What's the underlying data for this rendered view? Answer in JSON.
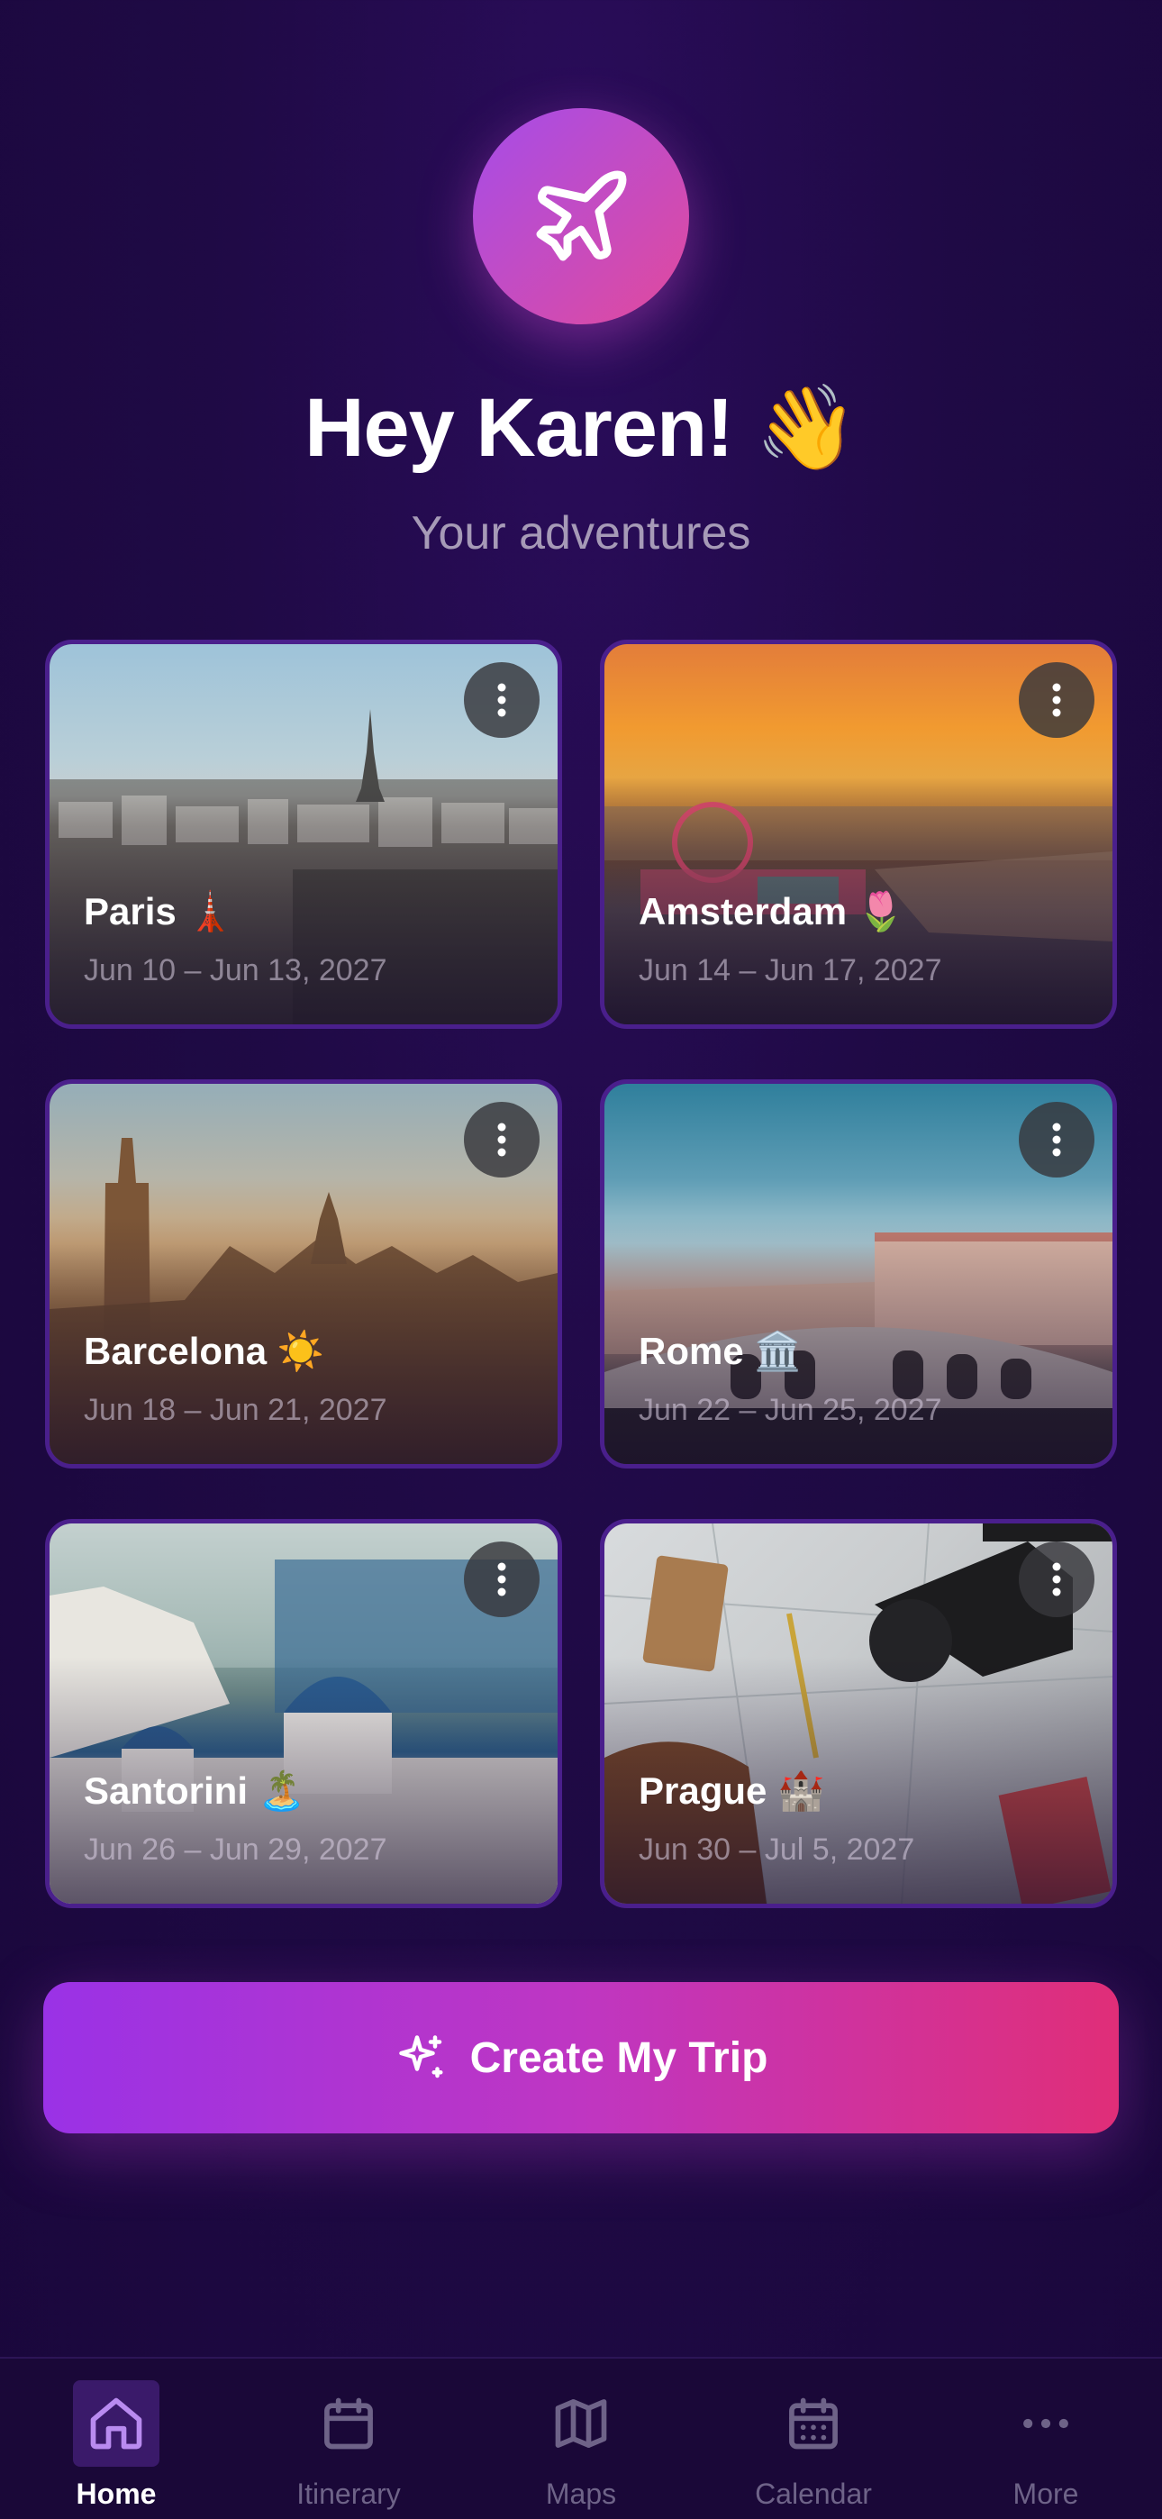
{
  "header": {
    "icon": "airplane-icon",
    "greeting": "Hey Karen! 👋",
    "subtitle": "Your adventures"
  },
  "trips": [
    {
      "title": "Paris 🗼",
      "dates": "Jun 10 – Jun 13, 2027"
    },
    {
      "title": "Amsterdam 🌷",
      "dates": "Jun 14 – Jun 17, 2027"
    },
    {
      "title": "Barcelona ☀️",
      "dates": "Jun 18 – Jun 21, 2027"
    },
    {
      "title": "Rome 🏛️",
      "dates": "Jun 22 – Jun 25, 2027"
    },
    {
      "title": "Santorini 🏝️",
      "dates": "Jun 26 – Jun 29, 2027"
    },
    {
      "title": "Prague 🏰",
      "dates": "Jun 30 – Jul 5, 2027"
    }
  ],
  "cta": {
    "label": "Create My Trip",
    "icon": "sparkle-icon"
  },
  "tabbar": {
    "items": [
      {
        "label": "Home",
        "icon": "home-icon",
        "active": true
      },
      {
        "label": "Itinerary",
        "icon": "calendar-icon"
      },
      {
        "label": "Maps",
        "icon": "map-icon"
      },
      {
        "label": "Calendar",
        "icon": "calendar-grid-icon"
      },
      {
        "label": "More",
        "icon": "more-icon"
      }
    ]
  },
  "colors": {
    "background": "#1f0a45",
    "accent_start": "#9a32e6",
    "accent_end": "#e02e78",
    "card_border": "#4a1f8c",
    "muted_text": "#a69ab7"
  }
}
